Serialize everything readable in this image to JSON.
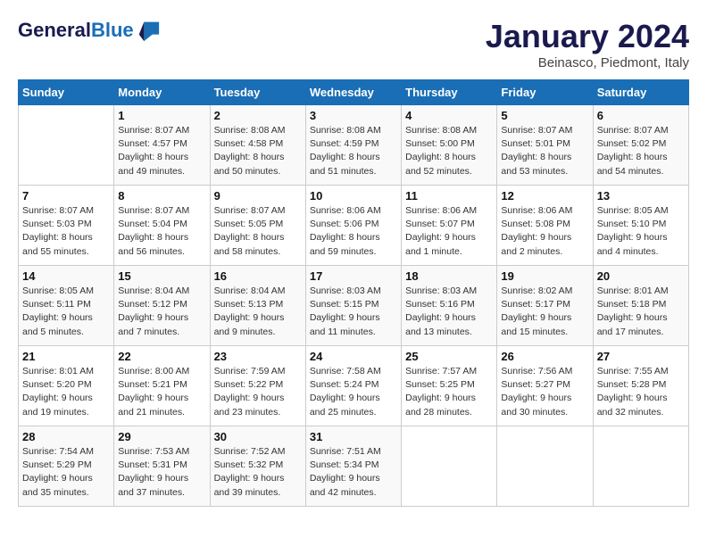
{
  "logo": {
    "line1": "General",
    "line2": "Blue"
  },
  "title": "January 2024",
  "subtitle": "Beinasco, Piedmont, Italy",
  "days_of_week": [
    "Sunday",
    "Monday",
    "Tuesday",
    "Wednesday",
    "Thursday",
    "Friday",
    "Saturday"
  ],
  "weeks": [
    [
      {
        "day": "",
        "info": ""
      },
      {
        "day": "1",
        "info": "Sunrise: 8:07 AM\nSunset: 4:57 PM\nDaylight: 8 hours\nand 49 minutes."
      },
      {
        "day": "2",
        "info": "Sunrise: 8:08 AM\nSunset: 4:58 PM\nDaylight: 8 hours\nand 50 minutes."
      },
      {
        "day": "3",
        "info": "Sunrise: 8:08 AM\nSunset: 4:59 PM\nDaylight: 8 hours\nand 51 minutes."
      },
      {
        "day": "4",
        "info": "Sunrise: 8:08 AM\nSunset: 5:00 PM\nDaylight: 8 hours\nand 52 minutes."
      },
      {
        "day": "5",
        "info": "Sunrise: 8:07 AM\nSunset: 5:01 PM\nDaylight: 8 hours\nand 53 minutes."
      },
      {
        "day": "6",
        "info": "Sunrise: 8:07 AM\nSunset: 5:02 PM\nDaylight: 8 hours\nand 54 minutes."
      }
    ],
    [
      {
        "day": "7",
        "info": "Sunrise: 8:07 AM\nSunset: 5:03 PM\nDaylight: 8 hours\nand 55 minutes."
      },
      {
        "day": "8",
        "info": "Sunrise: 8:07 AM\nSunset: 5:04 PM\nDaylight: 8 hours\nand 56 minutes."
      },
      {
        "day": "9",
        "info": "Sunrise: 8:07 AM\nSunset: 5:05 PM\nDaylight: 8 hours\nand 58 minutes."
      },
      {
        "day": "10",
        "info": "Sunrise: 8:06 AM\nSunset: 5:06 PM\nDaylight: 8 hours\nand 59 minutes."
      },
      {
        "day": "11",
        "info": "Sunrise: 8:06 AM\nSunset: 5:07 PM\nDaylight: 9 hours\nand 1 minute."
      },
      {
        "day": "12",
        "info": "Sunrise: 8:06 AM\nSunset: 5:08 PM\nDaylight: 9 hours\nand 2 minutes."
      },
      {
        "day": "13",
        "info": "Sunrise: 8:05 AM\nSunset: 5:10 PM\nDaylight: 9 hours\nand 4 minutes."
      }
    ],
    [
      {
        "day": "14",
        "info": "Sunrise: 8:05 AM\nSunset: 5:11 PM\nDaylight: 9 hours\nand 5 minutes."
      },
      {
        "day": "15",
        "info": "Sunrise: 8:04 AM\nSunset: 5:12 PM\nDaylight: 9 hours\nand 7 minutes."
      },
      {
        "day": "16",
        "info": "Sunrise: 8:04 AM\nSunset: 5:13 PM\nDaylight: 9 hours\nand 9 minutes."
      },
      {
        "day": "17",
        "info": "Sunrise: 8:03 AM\nSunset: 5:15 PM\nDaylight: 9 hours\nand 11 minutes."
      },
      {
        "day": "18",
        "info": "Sunrise: 8:03 AM\nSunset: 5:16 PM\nDaylight: 9 hours\nand 13 minutes."
      },
      {
        "day": "19",
        "info": "Sunrise: 8:02 AM\nSunset: 5:17 PM\nDaylight: 9 hours\nand 15 minutes."
      },
      {
        "day": "20",
        "info": "Sunrise: 8:01 AM\nSunset: 5:18 PM\nDaylight: 9 hours\nand 17 minutes."
      }
    ],
    [
      {
        "day": "21",
        "info": "Sunrise: 8:01 AM\nSunset: 5:20 PM\nDaylight: 9 hours\nand 19 minutes."
      },
      {
        "day": "22",
        "info": "Sunrise: 8:00 AM\nSunset: 5:21 PM\nDaylight: 9 hours\nand 21 minutes."
      },
      {
        "day": "23",
        "info": "Sunrise: 7:59 AM\nSunset: 5:22 PM\nDaylight: 9 hours\nand 23 minutes."
      },
      {
        "day": "24",
        "info": "Sunrise: 7:58 AM\nSunset: 5:24 PM\nDaylight: 9 hours\nand 25 minutes."
      },
      {
        "day": "25",
        "info": "Sunrise: 7:57 AM\nSunset: 5:25 PM\nDaylight: 9 hours\nand 28 minutes."
      },
      {
        "day": "26",
        "info": "Sunrise: 7:56 AM\nSunset: 5:27 PM\nDaylight: 9 hours\nand 30 minutes."
      },
      {
        "day": "27",
        "info": "Sunrise: 7:55 AM\nSunset: 5:28 PM\nDaylight: 9 hours\nand 32 minutes."
      }
    ],
    [
      {
        "day": "28",
        "info": "Sunrise: 7:54 AM\nSunset: 5:29 PM\nDaylight: 9 hours\nand 35 minutes."
      },
      {
        "day": "29",
        "info": "Sunrise: 7:53 AM\nSunset: 5:31 PM\nDaylight: 9 hours\nand 37 minutes."
      },
      {
        "day": "30",
        "info": "Sunrise: 7:52 AM\nSunset: 5:32 PM\nDaylight: 9 hours\nand 39 minutes."
      },
      {
        "day": "31",
        "info": "Sunrise: 7:51 AM\nSunset: 5:34 PM\nDaylight: 9 hours\nand 42 minutes."
      },
      {
        "day": "",
        "info": ""
      },
      {
        "day": "",
        "info": ""
      },
      {
        "day": "",
        "info": ""
      }
    ]
  ]
}
